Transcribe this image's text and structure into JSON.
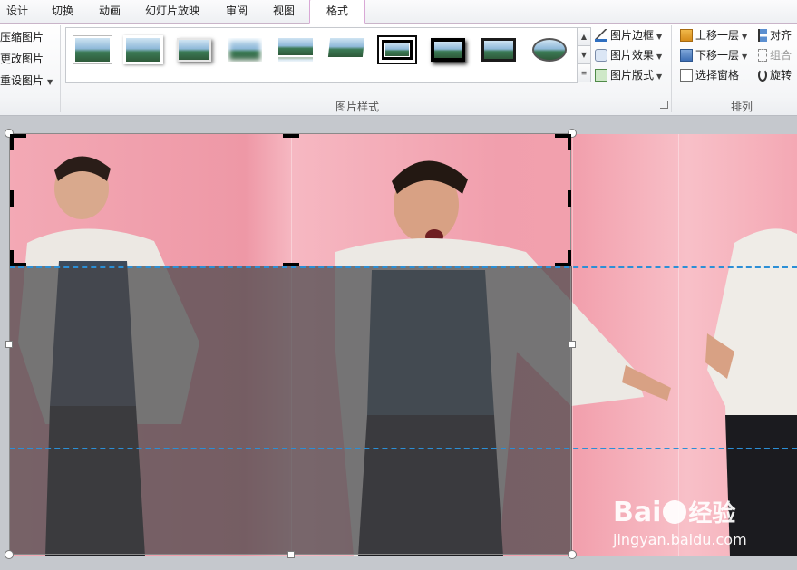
{
  "tabs": [
    {
      "label": "设计",
      "active": false
    },
    {
      "label": "切换",
      "active": false
    },
    {
      "label": "动画",
      "active": false
    },
    {
      "label": "幻灯片放映",
      "active": false
    },
    {
      "label": "审阅",
      "active": false
    },
    {
      "label": "视图",
      "active": false
    },
    {
      "label": "格式",
      "active": true
    }
  ],
  "adjust": {
    "compress": "压缩图片",
    "change": "更改图片",
    "reset": "重设图片"
  },
  "picture_styles": {
    "group_label": "图片样式",
    "border": "图片边框",
    "effects": "图片效果",
    "layout": "图片版式"
  },
  "arrange": {
    "group_label": "排列",
    "bring_forward": "上移一层",
    "send_backward": "下移一层",
    "selection_pane": "选择窗格",
    "align": "对齐",
    "group": "组合",
    "rotate": "旋转"
  },
  "watermark": {
    "brand": "Bai",
    "brand_tail": "经验",
    "url": "jingyan.baidu.com"
  },
  "colors": {
    "accent_tab_border": "#d9a8d6",
    "guide_dash": "#2b8fd6",
    "shade": "#46464a"
  }
}
